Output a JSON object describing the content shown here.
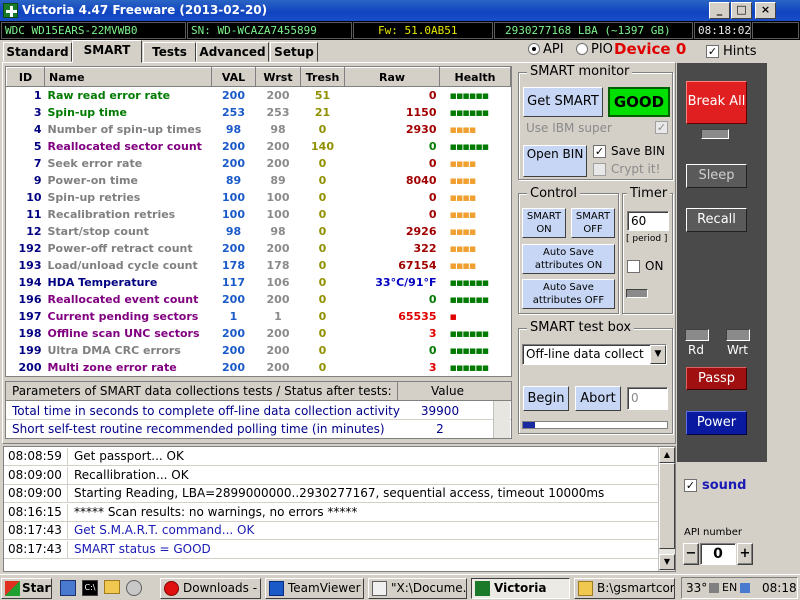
{
  "window": {
    "title": "Victoria 4.47  Freeware (2013-02-20)",
    "buttons": [
      "_",
      "□",
      "×"
    ]
  },
  "info_bar": {
    "model": "WDC WD15EARS-22MVWB0",
    "serial": "SN: WD-WCAZA7455899",
    "firmware": "Fw: 51.0AB51",
    "capacity": "2930277168 LBA (~1397 GB)",
    "clock": "08:18:02"
  },
  "tabs": [
    {
      "label": "Standard",
      "active": false
    },
    {
      "label": "SMART",
      "active": true
    },
    {
      "label": "Tests",
      "active": false
    },
    {
      "label": "Advanced",
      "active": false
    },
    {
      "label": "Setup",
      "active": false
    }
  ],
  "mode": {
    "api_label": "API",
    "pio_label": "PIO",
    "selected": "API",
    "device_label": "Device 0",
    "hints_label": "Hints",
    "hints_checked": true
  },
  "smart_table": {
    "columns": [
      "ID",
      "Name",
      "VAL",
      "Wrst",
      "Tresh",
      "Raw",
      "Health"
    ],
    "rows": [
      {
        "id": "1",
        "name": "Raw read error rate",
        "val": "200",
        "wrst": "200",
        "tresh": "51",
        "raw": "0",
        "health": "▪▪▪▪▪▪",
        "name_color": "#007a00",
        "raw_color": "#a00000",
        "health_color": "#007a00"
      },
      {
        "id": "3",
        "name": "Spin-up time",
        "val": "253",
        "wrst": "253",
        "tresh": "21",
        "raw": "1150",
        "health": "▪▪▪▪▪▪",
        "name_color": "#007a00",
        "raw_color": "#a00000",
        "health_color": "#007a00"
      },
      {
        "id": "4",
        "name": "Number of spin-up times",
        "val": "98",
        "wrst": "98",
        "tresh": "0",
        "raw": "2930",
        "health": "▪▪▪▪",
        "name_color": "#808080",
        "raw_color": "#a00000",
        "health_color": "#f0a030"
      },
      {
        "id": "5",
        "name": "Reallocated sector count",
        "val": "200",
        "wrst": "200",
        "tresh": "140",
        "raw": "0",
        "health": "▪▪▪▪▪▪",
        "name_color": "#800080",
        "raw_color": "#007a00",
        "health_color": "#007a00"
      },
      {
        "id": "7",
        "name": "Seek error rate",
        "val": "200",
        "wrst": "200",
        "tresh": "0",
        "raw": "0",
        "health": "▪▪▪▪",
        "name_color": "#808080",
        "raw_color": "#a00000",
        "health_color": "#f0a030"
      },
      {
        "id": "9",
        "name": "Power-on time",
        "val": "89",
        "wrst": "89",
        "tresh": "0",
        "raw": "8040",
        "health": "▪▪▪▪",
        "name_color": "#808080",
        "raw_color": "#a00000",
        "health_color": "#f0a030"
      },
      {
        "id": "10",
        "name": "Spin-up retries",
        "val": "100",
        "wrst": "100",
        "tresh": "0",
        "raw": "0",
        "health": "▪▪▪▪",
        "name_color": "#808080",
        "raw_color": "#a00000",
        "health_color": "#f0a030"
      },
      {
        "id": "11",
        "name": "Recalibration retries",
        "val": "100",
        "wrst": "100",
        "tresh": "0",
        "raw": "0",
        "health": "▪▪▪▪",
        "name_color": "#808080",
        "raw_color": "#a00000",
        "health_color": "#f0a030"
      },
      {
        "id": "12",
        "name": "Start/stop count",
        "val": "98",
        "wrst": "98",
        "tresh": "0",
        "raw": "2926",
        "health": "▪▪▪▪",
        "name_color": "#808080",
        "raw_color": "#a00000",
        "health_color": "#f0a030"
      },
      {
        "id": "192",
        "name": "Power-off retract count",
        "val": "200",
        "wrst": "200",
        "tresh": "0",
        "raw": "322",
        "health": "▪▪▪▪",
        "name_color": "#808080",
        "raw_color": "#a00000",
        "health_color": "#f0a030"
      },
      {
        "id": "193",
        "name": "Load/unload cycle count",
        "val": "178",
        "wrst": "178",
        "tresh": "0",
        "raw": "67154",
        "health": "▪▪▪▪",
        "name_color": "#808080",
        "raw_color": "#a00000",
        "health_color": "#f0a030"
      },
      {
        "id": "194",
        "name": "HDA Temperature",
        "val": "117",
        "wrst": "106",
        "tresh": "0",
        "raw": "33°C/91°F",
        "health": "▪▪▪▪▪▪",
        "name_color": "#000080",
        "raw_color": "#0000c0",
        "health_color": "#007a00"
      },
      {
        "id": "196",
        "name": "Reallocated event count",
        "val": "200",
        "wrst": "200",
        "tresh": "0",
        "raw": "0",
        "health": "▪▪▪▪▪▪",
        "name_color": "#800080",
        "raw_color": "#007a00",
        "health_color": "#007a00"
      },
      {
        "id": "197",
        "name": "Current pending sectors",
        "val": "1",
        "wrst": "1",
        "tresh": "0",
        "raw": "65535",
        "health": "▪",
        "name_color": "#800080",
        "raw_color": "#e00000",
        "health_color": "#e00000"
      },
      {
        "id": "198",
        "name": "Offline scan UNC sectors",
        "val": "200",
        "wrst": "200",
        "tresh": "0",
        "raw": "3",
        "health": "▪▪▪▪▪▪",
        "name_color": "#800080",
        "raw_color": "#e00000",
        "health_color": "#007a00"
      },
      {
        "id": "199",
        "name": "Ultra DMA CRC errors",
        "val": "200",
        "wrst": "200",
        "tresh": "0",
        "raw": "0",
        "health": "▪▪▪▪▪▪",
        "name_color": "#808080",
        "raw_color": "#007a00",
        "health_color": "#007a00"
      },
      {
        "id": "200",
        "name": "Multi zone error rate",
        "val": "200",
        "wrst": "200",
        "tresh": "0",
        "raw": "3",
        "health": "▪▪▪▪▪▪",
        "name_color": "#800080",
        "raw_color": "#e00000",
        "health_color": "#007a00"
      }
    ]
  },
  "params": {
    "header_label": "Parameters of SMART data collections tests / Status after tests:",
    "header_value": "Value",
    "rows": [
      {
        "label": "Total time in seconds to complete off-line data collection activity",
        "value": "39900"
      },
      {
        "label": "Short self-test routine recommended polling time (in minutes)",
        "value": "2"
      }
    ]
  },
  "log": [
    {
      "time": "08:08:59",
      "msg": "Get passport... OK",
      "color": "#000000"
    },
    {
      "time": "08:09:00",
      "msg": "Recallibration... OK",
      "color": "#000000"
    },
    {
      "time": "08:09:00",
      "msg": "Starting Reading, LBA=2899000000..2930277167, sequential access, timeout 10000ms",
      "color": "#000000"
    },
    {
      "time": "08:16:15",
      "msg": "***** Scan results: no warnings, no errors *****",
      "color": "#000000"
    },
    {
      "time": "08:17:43",
      "msg": "Get S.M.A.R.T. command... OK",
      "color": "#1a1ab4"
    },
    {
      "time": "08:17:43",
      "msg": "SMART status = GOOD",
      "color": "#1a1ab4"
    }
  ],
  "smart_monitor": {
    "title": "SMART monitor",
    "get_smart_label": "Get SMART",
    "status_label": "GOOD",
    "use_ibm_label": "Use IBM super",
    "open_bin_label": "Open BIN",
    "save_bin_label": "Save BIN",
    "crypt_label": "Crypt it!",
    "save_bin_checked": true,
    "crypt_checked": false,
    "use_ibm_checked": true
  },
  "control": {
    "title": "Control",
    "smart_on": "SMART ON",
    "smart_off": "SMART OFF",
    "auto_on": "Auto Save attributes ON",
    "auto_off": "Auto Save attributes OFF"
  },
  "timer": {
    "title": "Timer",
    "value": "60",
    "period_label": "[ period ]",
    "on_label": "ON",
    "on_checked": false
  },
  "test_box": {
    "title": "SMART test box",
    "selected": "Off-line data collect",
    "begin_label": "Begin",
    "abort_label": "Abort",
    "counter_value": "0",
    "progress": 0.08
  },
  "right_panel": {
    "break_all": "Break All",
    "sleep": "Sleep",
    "recall": "Recall",
    "rd_label": "Rd",
    "wrt_label": "Wrt",
    "passp": "Passp",
    "power": "Power",
    "sound_label": "sound",
    "sound_checked": true,
    "api_number_label": "API number",
    "api_number_value": "0",
    "minus": "−",
    "plus": "+"
  },
  "taskbar": {
    "start_label": "Start",
    "items": [
      {
        "label": "Downloads - ...",
        "icon": "opera-icon",
        "active": false
      },
      {
        "label": "TeamViewer",
        "icon": "teamviewer-icon",
        "active": false
      },
      {
        "label": "\"X:\\Docume...",
        "icon": "document-icon",
        "active": false
      },
      {
        "label": "Victoria",
        "icon": "victoria-icon",
        "active": true
      },
      {
        "label": "B:\\gsmartcon...",
        "icon": "folder-icon",
        "active": false
      }
    ],
    "temperature": "33°",
    "language": "EN",
    "clock": "08:18"
  },
  "colors": {
    "titlebar": "#1043c0",
    "infobar_text": "#7cf58a",
    "good": "#00e000",
    "device": "#e00000",
    "break_all": "#e02020",
    "right_panel": "#4a4a4a",
    "power": "#0a1aa0",
    "passp": "#a01010"
  }
}
